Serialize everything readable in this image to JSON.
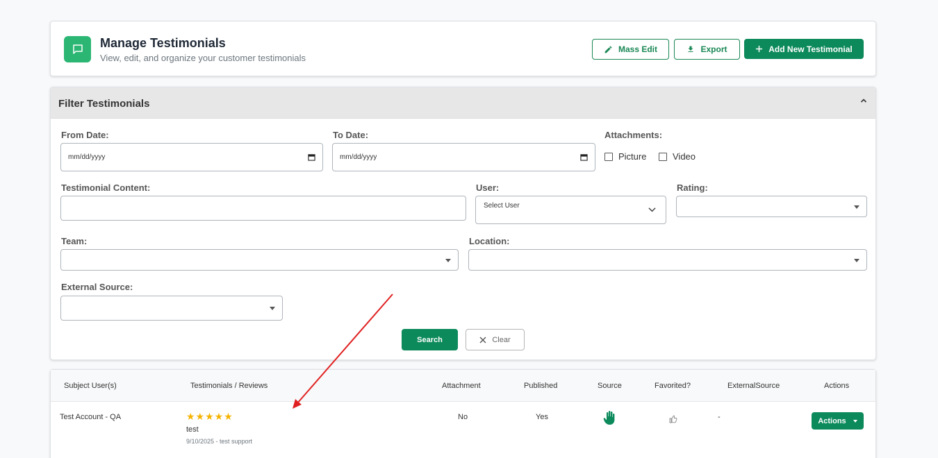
{
  "header": {
    "title": "Manage Testimonials",
    "subtitle": "View, edit, and organize your customer testimonials",
    "mass_edit_label": "Mass Edit",
    "export_label": "Export",
    "add_label": "Add New Testimonial"
  },
  "filter": {
    "title": "Filter Testimonials",
    "from_date_label": "From Date:",
    "from_date_value": "mm/dd/yyyy",
    "to_date_label": "To Date:",
    "to_date_value": "mm/dd/yyyy",
    "attachments_label": "Attachments:",
    "picture_label": "Picture",
    "video_label": "Video",
    "content_label": "Testimonial Content:",
    "user_label": "User:",
    "user_placeholder": "Select User",
    "rating_label": "Rating:",
    "team_label": "Team:",
    "location_label": "Location:",
    "external_source_label": "External Source:",
    "search_label": "Search",
    "clear_label": "Clear"
  },
  "table": {
    "columns": [
      "Subject User(s)",
      "Testimonials / Reviews",
      "Attachment",
      "Published",
      "Source",
      "Favorited?",
      "ExternalSource",
      "Actions"
    ],
    "rows": [
      {
        "subject": "Test Account - QA",
        "stars": "★★★★★",
        "rating": 5,
        "review": "test",
        "meta": "9/10/2025 - test support",
        "attachment": "No",
        "published": "Yes",
        "source_icon": "hand-icon",
        "favorited_icon": "thumbs-up-icon",
        "external_source": "-",
        "actions_label": "Actions"
      }
    ]
  },
  "colors": {
    "accent": "#0d8a5c",
    "icon_bg": "#2bb673",
    "star": "#f5b301",
    "annotation_arrow": "#e02020"
  }
}
